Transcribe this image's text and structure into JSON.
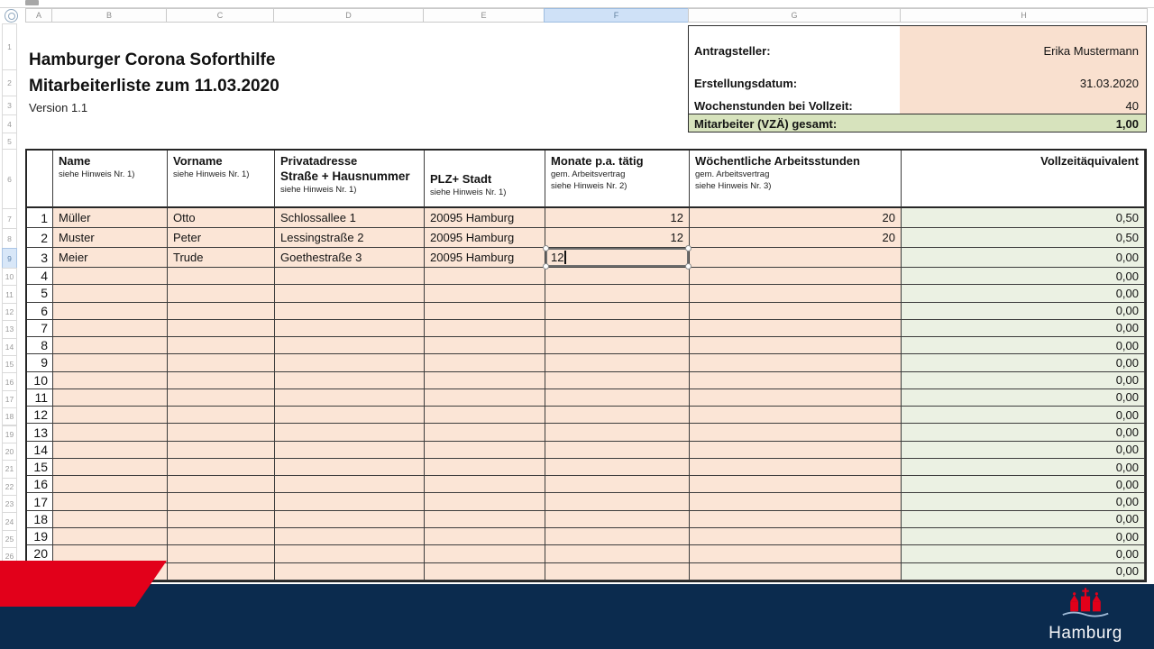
{
  "spreadsheet": {
    "column_headers": [
      "A",
      "B",
      "C",
      "D",
      "E",
      "F",
      "G",
      "H"
    ],
    "selected_column": "F",
    "row_headers": [
      "1",
      "2",
      "3",
      "4",
      "5",
      "6",
      "7",
      "8",
      "9",
      "10",
      "11",
      "12",
      "13",
      "14",
      "15",
      "16",
      "17",
      "18",
      "19",
      "20",
      "21",
      "22",
      "23",
      "24",
      "25",
      "26"
    ],
    "selected_row": "9"
  },
  "titles": {
    "line1": "Hamburger Corona Soforthilfe",
    "line2": "Mitarbeiterliste zum 11.03.2020",
    "version": "Version 1.1"
  },
  "info": {
    "fields": [
      {
        "label": "Antragsteller:",
        "value": "Erika Mustermann"
      },
      {
        "label": "Erstellungsdatum:",
        "value": "31.03.2020"
      },
      {
        "label": "Wochenstunden bei Vollzeit:",
        "value": "40"
      },
      {
        "label": "Mitarbeiter (VZÄ) gesamt:",
        "value": "1,00"
      }
    ]
  },
  "table": {
    "headers": {
      "name": {
        "title": "Name",
        "note": "siehe Hinweis Nr. 1)"
      },
      "vorname": {
        "title": "Vorname",
        "note": "siehe Hinweis Nr. 1)"
      },
      "adresse": {
        "title": "Privatadresse",
        "subtitle": "Straße + Hausnummer",
        "note": "siehe Hinweis Nr. 1)"
      },
      "plz": {
        "title": "PLZ+ Stadt",
        "note": "siehe Hinweis Nr. 1)"
      },
      "monate": {
        "title": "Monate p.a. tätig",
        "note1": "gem. Arbeitsvertrag",
        "note2": "siehe Hinweis Nr. 2)"
      },
      "stunden": {
        "title": "Wöchentliche Arbeitsstunden",
        "note1": "gem. Arbeitsvertrag",
        "note2": "siehe Hinweis Nr. 3)"
      },
      "vza": {
        "title": "Vollzeitäquivalent"
      }
    },
    "rows": [
      {
        "n": "1",
        "name": "Müller",
        "vorname": "Otto",
        "adresse": "Schlossallee 1",
        "plz": "20095 Hamburg",
        "monate": "12",
        "stunden": "20",
        "vza": "0,50"
      },
      {
        "n": "2",
        "name": "Muster",
        "vorname": "Peter",
        "adresse": "Lessingstraße 2",
        "plz": "20095 Hamburg",
        "monate": "12",
        "stunden": "20",
        "vza": "0,50"
      },
      {
        "n": "3",
        "name": "Meier",
        "vorname": "Trude",
        "adresse": "Goethestraße 3",
        "plz": "20095 Hamburg",
        "monate": "",
        "stunden": "",
        "vza": "0,00"
      },
      {
        "n": "4",
        "name": "",
        "vorname": "",
        "adresse": "",
        "plz": "",
        "monate": "",
        "stunden": "",
        "vza": "0,00"
      },
      {
        "n": "5",
        "name": "",
        "vorname": "",
        "adresse": "",
        "plz": "",
        "monate": "",
        "stunden": "",
        "vza": "0,00"
      },
      {
        "n": "6",
        "name": "",
        "vorname": "",
        "adresse": "",
        "plz": "",
        "monate": "",
        "stunden": "",
        "vza": "0,00"
      },
      {
        "n": "7",
        "name": "",
        "vorname": "",
        "adresse": "",
        "plz": "",
        "monate": "",
        "stunden": "",
        "vza": "0,00"
      },
      {
        "n": "8",
        "name": "",
        "vorname": "",
        "adresse": "",
        "plz": "",
        "monate": "",
        "stunden": "",
        "vza": "0,00"
      },
      {
        "n": "9",
        "name": "",
        "vorname": "",
        "adresse": "",
        "plz": "",
        "monate": "",
        "stunden": "",
        "vza": "0,00"
      },
      {
        "n": "10",
        "name": "",
        "vorname": "",
        "adresse": "",
        "plz": "",
        "monate": "",
        "stunden": "",
        "vza": "0,00"
      },
      {
        "n": "11",
        "name": "",
        "vorname": "",
        "adresse": "",
        "plz": "",
        "monate": "",
        "stunden": "",
        "vza": "0,00"
      },
      {
        "n": "12",
        "name": "",
        "vorname": "",
        "adresse": "",
        "plz": "",
        "monate": "",
        "stunden": "",
        "vza": "0,00"
      },
      {
        "n": "13",
        "name": "",
        "vorname": "",
        "adresse": "",
        "plz": "",
        "monate": "",
        "stunden": "",
        "vza": "0,00"
      },
      {
        "n": "14",
        "name": "",
        "vorname": "",
        "adresse": "",
        "plz": "",
        "monate": "",
        "stunden": "",
        "vza": "0,00"
      },
      {
        "n": "15",
        "name": "",
        "vorname": "",
        "adresse": "",
        "plz": "",
        "monate": "",
        "stunden": "",
        "vza": "0,00"
      },
      {
        "n": "16",
        "name": "",
        "vorname": "",
        "adresse": "",
        "plz": "",
        "monate": "",
        "stunden": "",
        "vza": "0,00"
      },
      {
        "n": "17",
        "name": "",
        "vorname": "",
        "adresse": "",
        "plz": "",
        "monate": "",
        "stunden": "",
        "vza": "0,00"
      },
      {
        "n": "18",
        "name": "",
        "vorname": "",
        "adresse": "",
        "plz": "",
        "monate": "",
        "stunden": "",
        "vza": "0,00"
      },
      {
        "n": "19",
        "name": "",
        "vorname": "",
        "adresse": "",
        "plz": "",
        "monate": "",
        "stunden": "",
        "vza": "0,00"
      },
      {
        "n": "20",
        "name": "",
        "vorname": "",
        "adresse": "",
        "plz": "",
        "monate": "",
        "stunden": "",
        "vza": "0,00"
      },
      {
        "n": "",
        "name": "",
        "vorname": "",
        "adresse": "",
        "plz": "",
        "monate": "",
        "stunden": "",
        "vza": "0,00"
      }
    ],
    "editing": {
      "row_index": 2,
      "column": "monate",
      "value": "12"
    }
  },
  "footer": {
    "logo_text": "Hamburg",
    "logo_icon": "hamburg-castle-icon"
  },
  "colors": {
    "peach_cell": "#fbe5d6",
    "green_cell": "#ebf1e3",
    "green_total": "#d7e3bd",
    "navy_footer": "#0b2b4e",
    "brand_red": "#e2001a",
    "selection_blue": "#cfe1f7"
  }
}
